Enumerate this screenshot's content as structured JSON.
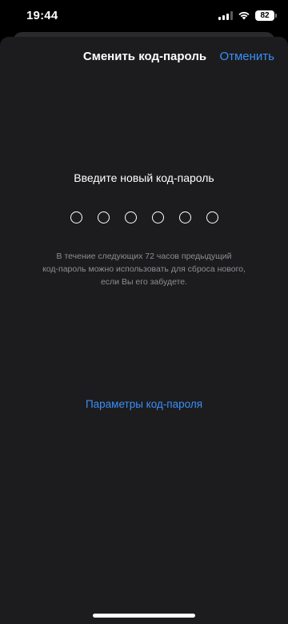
{
  "status_bar": {
    "time": "19:44",
    "battery_level": "82",
    "signal_bars_active": 3,
    "signal_bars_total": 4,
    "icons": [
      "cellular-signal-icon",
      "wifi-icon",
      "battery-icon"
    ]
  },
  "nav": {
    "title": "Сменить код-пароль",
    "cancel_label": "Отменить"
  },
  "passcode": {
    "prompt": "Введите новый код-пароль",
    "digits_total": 6,
    "digits_entered": 0
  },
  "hint": {
    "lines": [
      "В течение следующих 72 часов предыдущий",
      "код-пароль можно использовать для сброса нового,",
      "если Вы его забудете."
    ]
  },
  "options_link_label": "Параметры код-пароля",
  "colors": {
    "accent": "#3a8ff7",
    "sheet_background": "#1c1c1e",
    "secondary_text": "#8e8e93"
  }
}
